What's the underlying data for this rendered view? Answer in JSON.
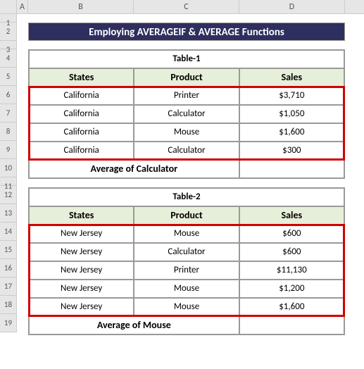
{
  "columns": {
    "A": "A",
    "B": "B",
    "C": "C",
    "D": "D"
  },
  "rows": [
    "1",
    "2",
    "3",
    "4",
    "5",
    "6",
    "7",
    "8",
    "9",
    "10",
    "11",
    "12",
    "13",
    "14",
    "15",
    "16",
    "17",
    "18",
    "19"
  ],
  "banner": "Employing AVERAGEIF & AVERAGE Functions",
  "table1": {
    "title": "Table-1",
    "headers": {
      "states": "States",
      "product": "Product",
      "sales": "Sales"
    },
    "rows": [
      {
        "state": "California",
        "product": "Printer",
        "sales": "$3,710"
      },
      {
        "state": "California",
        "product": "Calculator",
        "sales": "$1,050"
      },
      {
        "state": "California",
        "product": "Mouse",
        "sales": "$1,600"
      },
      {
        "state": "California",
        "product": "Calculator",
        "sales": "$300"
      }
    ],
    "avg_label": "Average of Calculator",
    "avg_value": ""
  },
  "table2": {
    "title": "Table-2",
    "headers": {
      "states": "States",
      "product": "Product",
      "sales": "Sales"
    },
    "rows": [
      {
        "state": "New Jersey",
        "product": "Mouse",
        "sales": "$600"
      },
      {
        "state": "New Jersey",
        "product": "Calculator",
        "sales": "$600"
      },
      {
        "state": "New Jersey",
        "product": "Printer",
        "sales": "$11,130"
      },
      {
        "state": "New Jersey",
        "product": "Mouse",
        "sales": "$1,200"
      },
      {
        "state": "New Jersey",
        "product": "Mouse",
        "sales": "$1,600"
      }
    ],
    "avg_label": "Average of Mouse",
    "avg_value": ""
  },
  "chart_data": [
    {
      "type": "table",
      "title": "Table-1",
      "columns": [
        "States",
        "Product",
        "Sales"
      ],
      "rows": [
        [
          "California",
          "Printer",
          3710
        ],
        [
          "California",
          "Calculator",
          1050
        ],
        [
          "California",
          "Mouse",
          1600
        ],
        [
          "California",
          "Calculator",
          300
        ]
      ],
      "summary": {
        "label": "Average of Calculator",
        "value": null
      }
    },
    {
      "type": "table",
      "title": "Table-2",
      "columns": [
        "States",
        "Product",
        "Sales"
      ],
      "rows": [
        [
          "New Jersey",
          "Mouse",
          600
        ],
        [
          "New Jersey",
          "Calculator",
          600
        ],
        [
          "New Jersey",
          "Printer",
          11130
        ],
        [
          "New Jersey",
          "Mouse",
          1200
        ],
        [
          "New Jersey",
          "Mouse",
          1600
        ]
      ],
      "summary": {
        "label": "Average of Mouse",
        "value": null
      }
    }
  ]
}
